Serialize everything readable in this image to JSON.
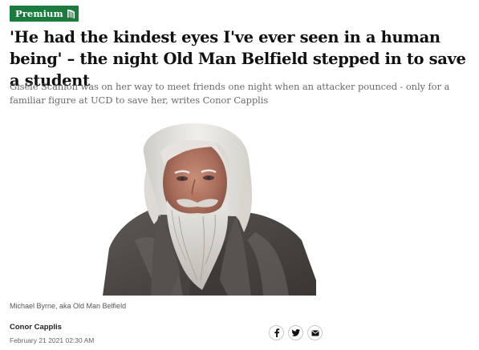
{
  "article": {
    "badge": {
      "label": "Premium",
      "icon": "harp-icon",
      "color": "#1b7a3e"
    },
    "headline": "'He had the kindest eyes I've ever seen in a human being' – the night Old Man Belfield stepped in to save a student",
    "standfirst": "Gisèle Scanlon was on her way to meet friends one night when an attacker pounced - only for a familiar figure at UCD to save her, writes Conor Capplis",
    "image": {
      "caption": "Michael Byrne, aka Old Man Belfield"
    },
    "byline": {
      "author": "Conor Capplis",
      "date": "February 21 2021 02:30 AM"
    },
    "share": [
      {
        "icon": "facebook-icon"
      },
      {
        "icon": "twitter-icon"
      },
      {
        "icon": "email-icon"
      }
    ]
  }
}
